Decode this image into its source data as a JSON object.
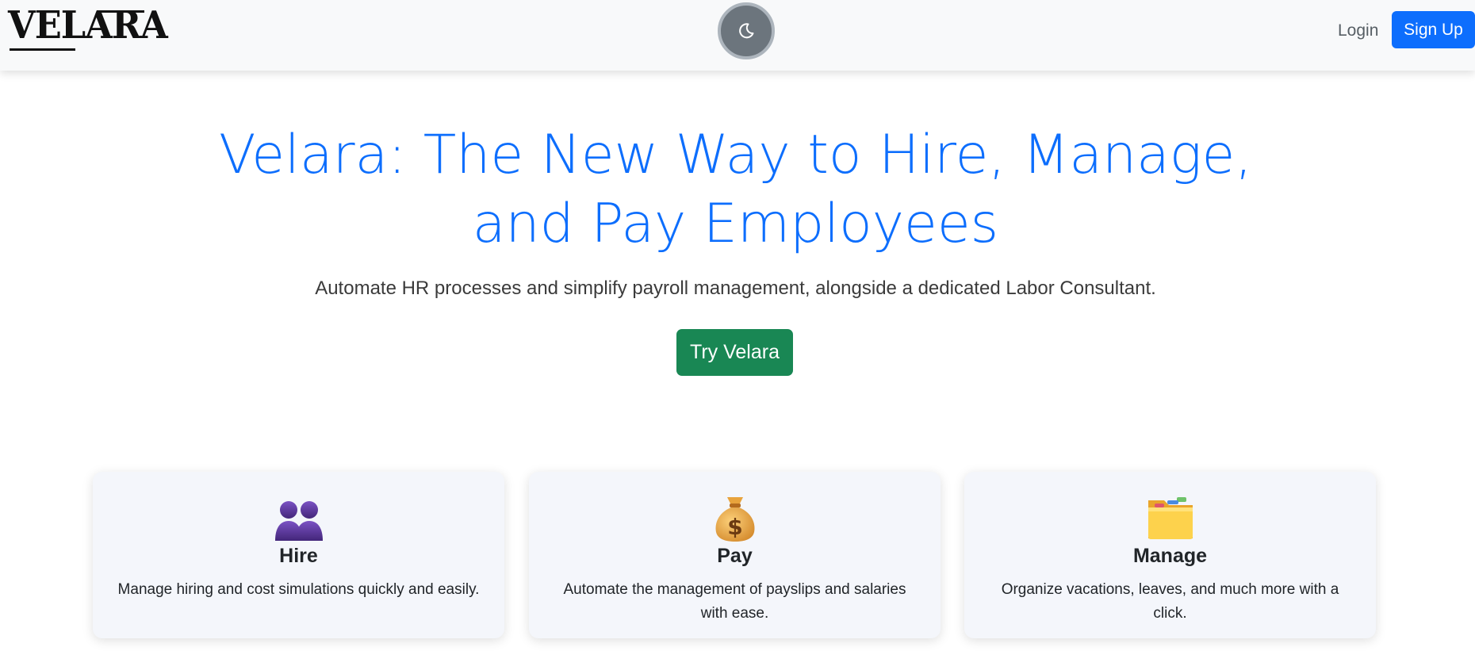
{
  "navbar": {
    "logo_text": "VELARA",
    "theme_toggle_icon": "moon-icon",
    "login_label": "Login",
    "signup_label": "Sign Up"
  },
  "hero": {
    "title": "Velara: The New Way to Hire, Manage, and Pay Employees",
    "subtitle": "Automate HR processes and simplify payroll management, alongside a dedicated Labor Consultant.",
    "cta_label": "Try Velara"
  },
  "features": [
    {
      "icon": "people-icon",
      "title": "Hire",
      "description": "Manage hiring and cost simulations quickly and easily."
    },
    {
      "icon": "money-bag-icon",
      "title": "Pay",
      "description": "Automate the management of payslips and salaries with ease."
    },
    {
      "icon": "folder-icon",
      "title": "Manage",
      "description": "Organize vacations, leaves, and much more with a click."
    }
  ],
  "colors": {
    "primary": "#0d6efd",
    "success": "#198754",
    "toggle": "#6c757d",
    "navbar_bg": "#f8f9fa",
    "card_bg": "#f4f6fb"
  }
}
